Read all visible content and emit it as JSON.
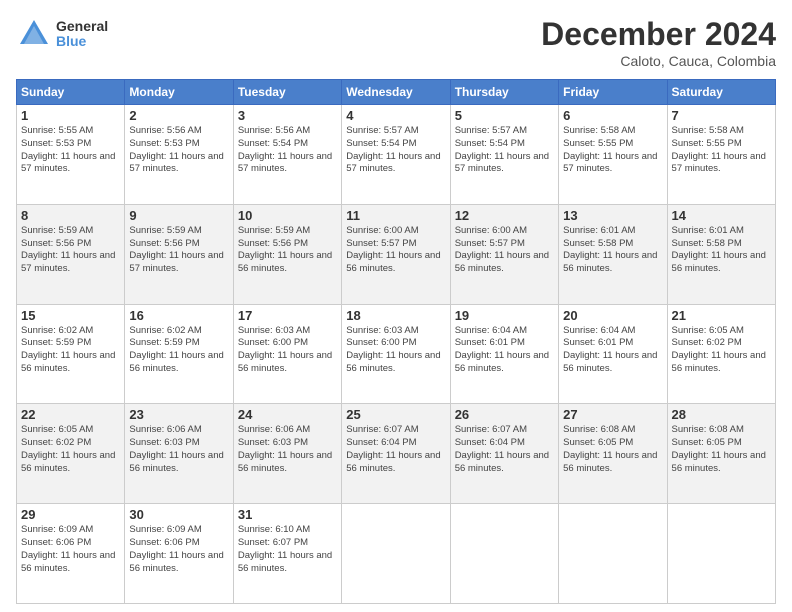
{
  "logo": {
    "general": "General",
    "blue": "Blue"
  },
  "title": "December 2024",
  "subtitle": "Caloto, Cauca, Colombia",
  "days_of_week": [
    "Sunday",
    "Monday",
    "Tuesday",
    "Wednesday",
    "Thursday",
    "Friday",
    "Saturday"
  ],
  "weeks": [
    [
      {
        "day": "1",
        "sunrise": "5:55 AM",
        "sunset": "5:53 PM",
        "daylight": "11 hours and 57 minutes."
      },
      {
        "day": "2",
        "sunrise": "5:56 AM",
        "sunset": "5:53 PM",
        "daylight": "11 hours and 57 minutes."
      },
      {
        "day": "3",
        "sunrise": "5:56 AM",
        "sunset": "5:54 PM",
        "daylight": "11 hours and 57 minutes."
      },
      {
        "day": "4",
        "sunrise": "5:57 AM",
        "sunset": "5:54 PM",
        "daylight": "11 hours and 57 minutes."
      },
      {
        "day": "5",
        "sunrise": "5:57 AM",
        "sunset": "5:54 PM",
        "daylight": "11 hours and 57 minutes."
      },
      {
        "day": "6",
        "sunrise": "5:58 AM",
        "sunset": "5:55 PM",
        "daylight": "11 hours and 57 minutes."
      },
      {
        "day": "7",
        "sunrise": "5:58 AM",
        "sunset": "5:55 PM",
        "daylight": "11 hours and 57 minutes."
      }
    ],
    [
      {
        "day": "8",
        "sunrise": "5:59 AM",
        "sunset": "5:56 PM",
        "daylight": "11 hours and 57 minutes."
      },
      {
        "day": "9",
        "sunrise": "5:59 AM",
        "sunset": "5:56 PM",
        "daylight": "11 hours and 57 minutes."
      },
      {
        "day": "10",
        "sunrise": "5:59 AM",
        "sunset": "5:56 PM",
        "daylight": "11 hours and 56 minutes."
      },
      {
        "day": "11",
        "sunrise": "6:00 AM",
        "sunset": "5:57 PM",
        "daylight": "11 hours and 56 minutes."
      },
      {
        "day": "12",
        "sunrise": "6:00 AM",
        "sunset": "5:57 PM",
        "daylight": "11 hours and 56 minutes."
      },
      {
        "day": "13",
        "sunrise": "6:01 AM",
        "sunset": "5:58 PM",
        "daylight": "11 hours and 56 minutes."
      },
      {
        "day": "14",
        "sunrise": "6:01 AM",
        "sunset": "5:58 PM",
        "daylight": "11 hours and 56 minutes."
      }
    ],
    [
      {
        "day": "15",
        "sunrise": "6:02 AM",
        "sunset": "5:59 PM",
        "daylight": "11 hours and 56 minutes."
      },
      {
        "day": "16",
        "sunrise": "6:02 AM",
        "sunset": "5:59 PM",
        "daylight": "11 hours and 56 minutes."
      },
      {
        "day": "17",
        "sunrise": "6:03 AM",
        "sunset": "6:00 PM",
        "daylight": "11 hours and 56 minutes."
      },
      {
        "day": "18",
        "sunrise": "6:03 AM",
        "sunset": "6:00 PM",
        "daylight": "11 hours and 56 minutes."
      },
      {
        "day": "19",
        "sunrise": "6:04 AM",
        "sunset": "6:01 PM",
        "daylight": "11 hours and 56 minutes."
      },
      {
        "day": "20",
        "sunrise": "6:04 AM",
        "sunset": "6:01 PM",
        "daylight": "11 hours and 56 minutes."
      },
      {
        "day": "21",
        "sunrise": "6:05 AM",
        "sunset": "6:02 PM",
        "daylight": "11 hours and 56 minutes."
      }
    ],
    [
      {
        "day": "22",
        "sunrise": "6:05 AM",
        "sunset": "6:02 PM",
        "daylight": "11 hours and 56 minutes."
      },
      {
        "day": "23",
        "sunrise": "6:06 AM",
        "sunset": "6:03 PM",
        "daylight": "11 hours and 56 minutes."
      },
      {
        "day": "24",
        "sunrise": "6:06 AM",
        "sunset": "6:03 PM",
        "daylight": "11 hours and 56 minutes."
      },
      {
        "day": "25",
        "sunrise": "6:07 AM",
        "sunset": "6:04 PM",
        "daylight": "11 hours and 56 minutes."
      },
      {
        "day": "26",
        "sunrise": "6:07 AM",
        "sunset": "6:04 PM",
        "daylight": "11 hours and 56 minutes."
      },
      {
        "day": "27",
        "sunrise": "6:08 AM",
        "sunset": "6:05 PM",
        "daylight": "11 hours and 56 minutes."
      },
      {
        "day": "28",
        "sunrise": "6:08 AM",
        "sunset": "6:05 PM",
        "daylight": "11 hours and 56 minutes."
      }
    ],
    [
      {
        "day": "29",
        "sunrise": "6:09 AM",
        "sunset": "6:06 PM",
        "daylight": "11 hours and 56 minutes."
      },
      {
        "day": "30",
        "sunrise": "6:09 AM",
        "sunset": "6:06 PM",
        "daylight": "11 hours and 56 minutes."
      },
      {
        "day": "31",
        "sunrise": "6:10 AM",
        "sunset": "6:07 PM",
        "daylight": "11 hours and 56 minutes."
      },
      null,
      null,
      null,
      null
    ]
  ]
}
